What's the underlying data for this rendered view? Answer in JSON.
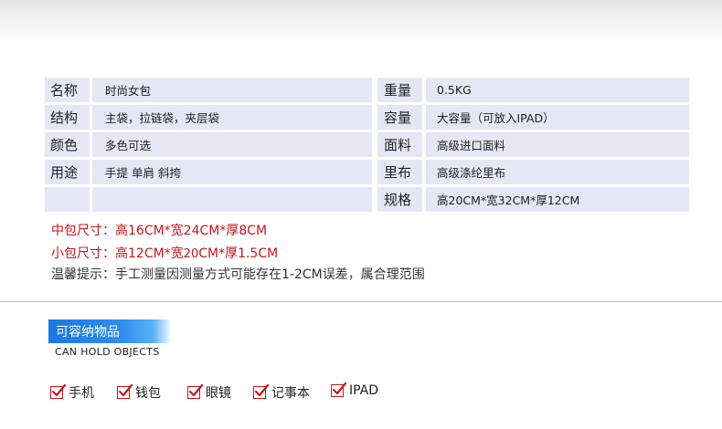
{
  "specs": {
    "rows": [
      {
        "label_left": "名称",
        "value_left": "时尚女包",
        "label_right": "重量",
        "value_right": "0.5KG"
      },
      {
        "label_left": "结构",
        "value_left": "主袋，拉链袋，夹层袋",
        "label_right": "容量",
        "value_right": "大容量（可放入IPAD）"
      },
      {
        "label_left": "颜色",
        "value_left": "多色可选",
        "label_right": "面料",
        "value_right": "高级进口面料"
      },
      {
        "label_left": "用途",
        "value_left": "手提 单肩 斜挎",
        "label_right": "里布",
        "value_right": "高级涤纶里布"
      },
      {
        "label_left": "",
        "value_left": "",
        "label_right": "规格",
        "value_right": "高20CM*宽32CM*厚12CM"
      }
    ]
  },
  "notes": {
    "medium_size": "中包尺寸：高16CM*宽24CM*厚8CM",
    "small_size_a": "小包尺寸：高12CM*宽",
    "small_size_b": "20",
    "small_size_c": "CM*厚1.5CM",
    "tip": "温馨提示：手工测量因测量方式可能存在1-2CM误差，属合理范围"
  },
  "section": {
    "title": "可容纳物品",
    "subtitle": "CAN HOLD OBJECTS"
  },
  "items": [
    {
      "label": "手机"
    },
    {
      "label": "钱包"
    },
    {
      "label": "眼镜"
    },
    {
      "label": "记事本"
    },
    {
      "label": "IPAD"
    }
  ],
  "colors": {
    "cell_bg": "#e6e6f7",
    "accent_red": "#c8161d",
    "tab_blue": "#1a78e0"
  }
}
